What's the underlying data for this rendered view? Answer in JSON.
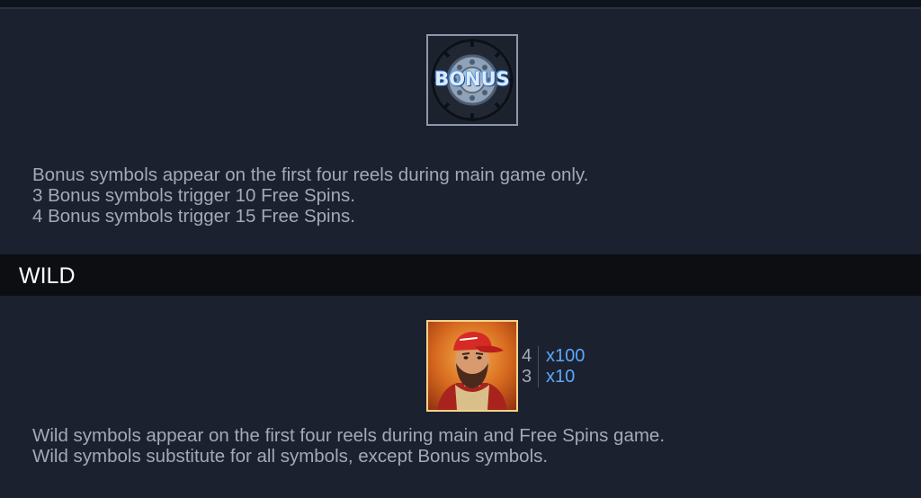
{
  "bonus": {
    "symbol_label": "BONUS",
    "symbol_icon": "bonus-tire-icon",
    "lines": [
      "Bonus symbols appear on the first four reels during main game only.",
      "3 Bonus symbols trigger 10 Free Spins.",
      "4 Bonus symbols trigger 15 Free Spins."
    ]
  },
  "wild": {
    "title": "WILD",
    "symbol_icon": "wild-driver-icon",
    "paytable": [
      {
        "count": "4",
        "payout": "x100"
      },
      {
        "count": "3",
        "payout": "x10"
      }
    ],
    "lines": [
      "Wild symbols appear on the first four reels during main and Free Spins game.",
      "Wild symbols substitute for all symbols, except Bonus symbols."
    ]
  },
  "colors": {
    "background": "#1c2130",
    "header_band": "#0c0e12",
    "body_text": "#a3a9b7",
    "payout_text": "#5aa8ff"
  }
}
